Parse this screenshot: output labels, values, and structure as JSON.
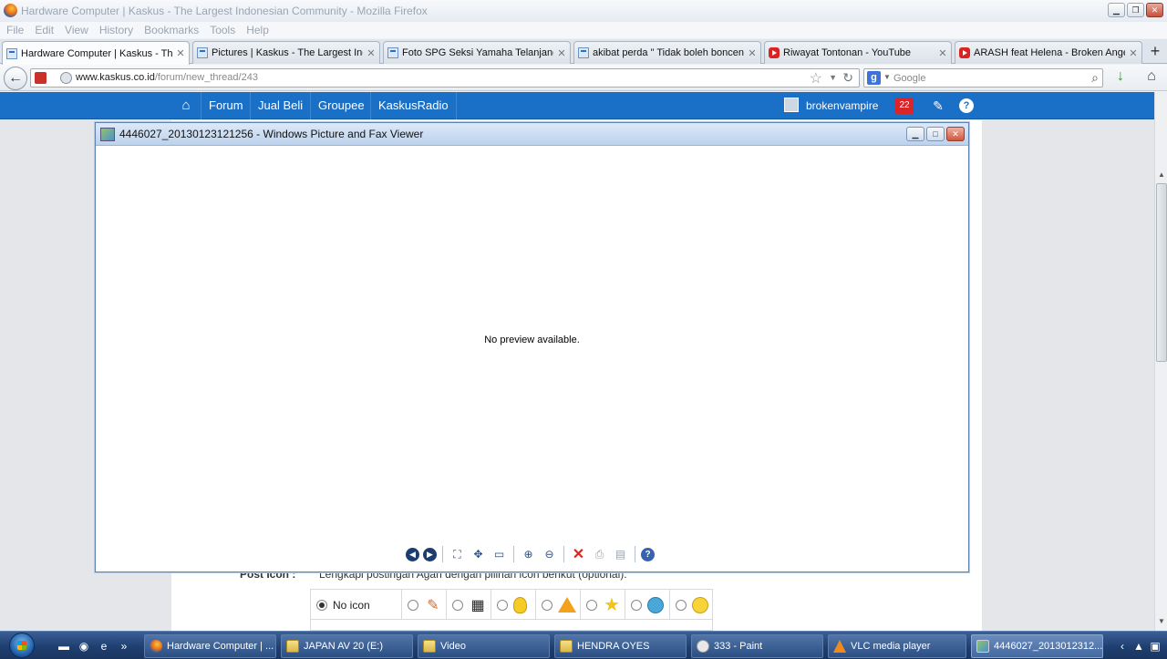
{
  "firefox": {
    "window_title": "Hardware Computer | Kaskus - The Largest Indonesian Community - Mozilla Firefox",
    "menu": [
      "File",
      "Edit",
      "View",
      "History",
      "Bookmarks",
      "Tools",
      "Help"
    ],
    "tabs": [
      {
        "label": "Hardware Computer | Kaskus - The...",
        "favicon": "kaskus-favicon-icon"
      },
      {
        "label": "Pictures | Kaskus - The Largest Ind...",
        "favicon": "kaskus-favicon-icon"
      },
      {
        "label": "Foto SPG Seksi Yamaha Telanjang ...",
        "favicon": "kaskus-favicon-icon"
      },
      {
        "label": "akibat perda \" Tidak boleh bonceng...",
        "favicon": "kaskus-favicon-icon"
      },
      {
        "label": "Riwayat Tontonan - YouTube",
        "favicon": "youtube-favicon-icon"
      },
      {
        "label": "ARASH feat Helena - Broken Angel ...",
        "favicon": "youtube-favicon-icon"
      }
    ],
    "url_domain": "www.kaskus.co.id",
    "url_path": "/forum/new_thread/243",
    "search_placeholder": "Google"
  },
  "kaskus": {
    "nav": [
      "Forum",
      "Jual Beli",
      "Groupee",
      "KaskusRadio"
    ],
    "username": "brokenvampire",
    "notification_count": "22",
    "post_icon_label": "Post Icon :",
    "post_icon_desc": "Lengkapi postingan Agan dengan pilihan icon berikut (optional).",
    "no_icon_label": "No icon",
    "icons": [
      "pencil-icon",
      "clapperboard-icon",
      "lightbulb-icon",
      "warning-icon",
      "star-icon",
      "cool-face-icon",
      "smile-face-icon"
    ]
  },
  "viewer": {
    "title": "4446027_20130123121256 - Windows Picture and Fax Viewer",
    "preview_text": "No preview available.",
    "toolbar": [
      "previous-image",
      "next-image",
      "best-fit",
      "actual-size",
      "slideshow",
      "zoom-in",
      "zoom-out",
      "delete",
      "print",
      "copy-to",
      "help"
    ]
  },
  "taskbar": {
    "items": [
      {
        "label": "Hardware Computer | ...",
        "icon": "firefox-icon"
      },
      {
        "label": "JAPAN AV 20 (E:)",
        "icon": "folder-icon"
      },
      {
        "label": "Video",
        "icon": "folder-icon"
      },
      {
        "label": "HENDRA OYES",
        "icon": "folder-icon"
      },
      {
        "label": "333 - Paint",
        "icon": "paint-icon"
      },
      {
        "label": "VLC media player",
        "icon": "vlc-icon"
      },
      {
        "label": "4446027_2013012312...",
        "icon": "picture-viewer-icon"
      }
    ]
  },
  "colors": {
    "kaskus_blue": "#1a6fc6",
    "taskbar": "#1f3f70",
    "notif_red": "#d9242a"
  }
}
